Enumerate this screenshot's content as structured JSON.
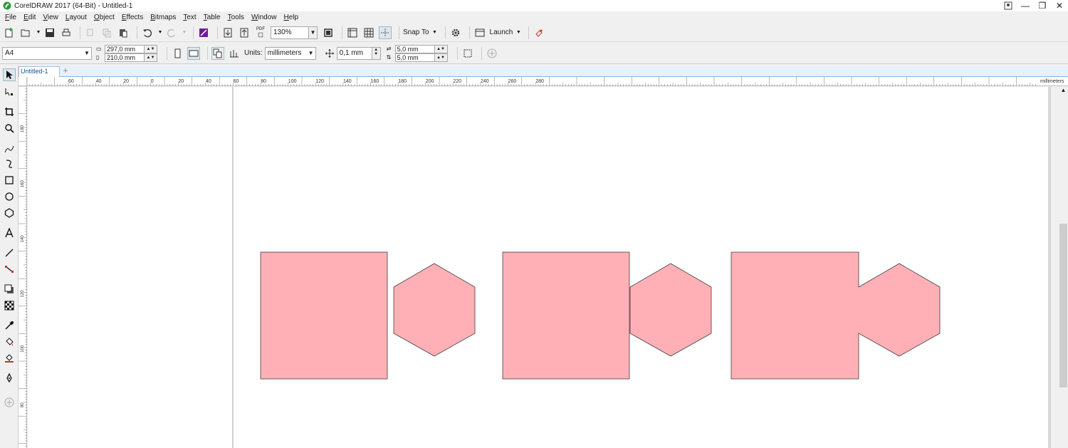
{
  "window": {
    "title": "CorelDRAW 2017 (64-Bit) - Untitled-1"
  },
  "menu": [
    "File",
    "Edit",
    "View",
    "Layout",
    "Object",
    "Effects",
    "Bitmaps",
    "Text",
    "Table",
    "Tools",
    "Window",
    "Help"
  ],
  "toolbar": {
    "zoom": "130%",
    "snap_to": "Snap To",
    "launch": "Launch",
    "pdf": "PDF"
  },
  "propbar": {
    "page_size": "A4",
    "width": "297,0 mm",
    "height": "210,0 mm",
    "units_label": "Units:",
    "units": "millimeters",
    "nudge": "0,1 mm",
    "dup_x": "5,0 mm",
    "dup_y": "5,0 mm"
  },
  "document": {
    "tab": "Untitled-1"
  },
  "ruler": {
    "h_ticks": [
      "60",
      "40",
      "20",
      "0",
      "20",
      "40",
      "60",
      "80",
      "100",
      "120",
      "140",
      "160",
      "180",
      "200",
      "220",
      "240",
      "260",
      "280"
    ],
    "h_unit": "millimeters",
    "v_ticks": [
      "180",
      "160",
      "140",
      "120",
      "100",
      "80"
    ]
  },
  "colors": {
    "shape_fill": "#ffb0b6",
    "shape_stroke": "#404040",
    "accent": "#2d6fb4"
  }
}
